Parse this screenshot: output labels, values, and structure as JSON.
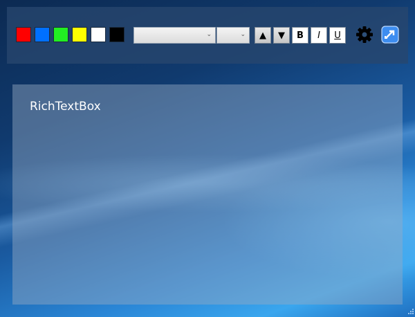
{
  "toolbar": {
    "colors": [
      {
        "name": "red",
        "hex": "#ff0000"
      },
      {
        "name": "blue",
        "hex": "#0070ff"
      },
      {
        "name": "green",
        "hex": "#22ee22"
      },
      {
        "name": "yellow",
        "hex": "#ffff00"
      },
      {
        "name": "white",
        "hex": "#ffffff"
      },
      {
        "name": "black",
        "hex": "#000000"
      }
    ],
    "font_family_value": "",
    "font_size_value": "",
    "increase_size_label": "▲",
    "decrease_size_label": "▼",
    "bold_label": "B",
    "italic_label": "I",
    "underline_label": "U",
    "settings_icon": "gear-icon",
    "app_icon": "switch-app-icon"
  },
  "editor": {
    "text": "RichTextBox"
  }
}
